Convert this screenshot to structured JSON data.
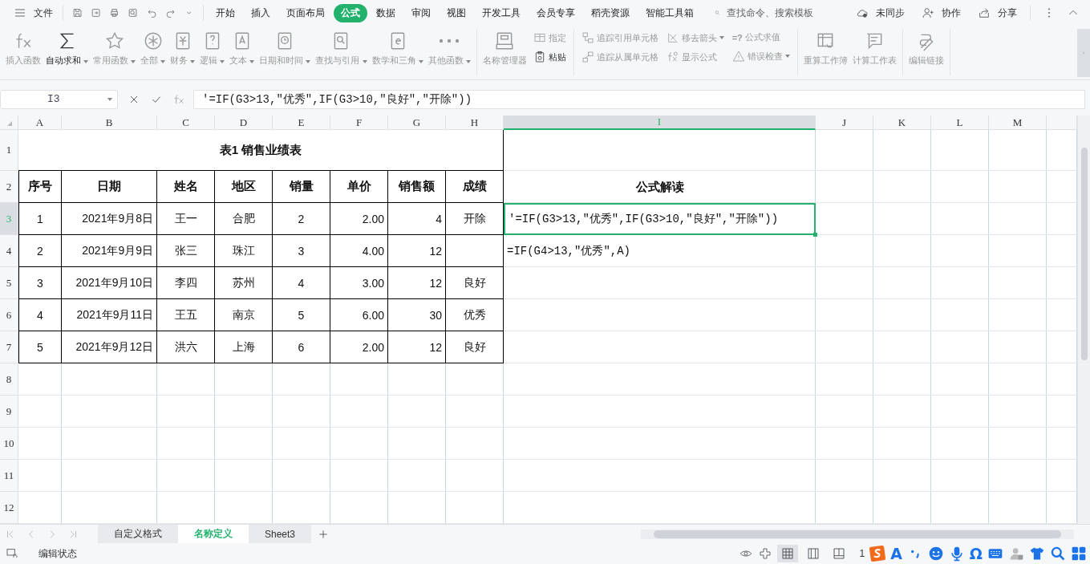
{
  "menu_bar": {
    "file_label": "文件",
    "tabs": [
      {
        "label": "开始",
        "selected": false
      },
      {
        "label": "插入",
        "selected": false
      },
      {
        "label": "页面布局",
        "selected": false
      },
      {
        "label": "公式",
        "selected": true
      },
      {
        "label": "数据",
        "selected": false
      },
      {
        "label": "审阅",
        "selected": false
      },
      {
        "label": "视图",
        "selected": false
      },
      {
        "label": "开发工具",
        "selected": false
      },
      {
        "label": "会员专享",
        "selected": false
      },
      {
        "label": "稻壳资源",
        "selected": false
      },
      {
        "label": "智能工具箱",
        "selected": false
      }
    ],
    "search": {
      "placeholder": "查找命令、搜索模板"
    },
    "actions": [
      "未同步",
      "协作",
      "分享"
    ]
  },
  "ribbon": {
    "groups": [
      [
        {
          "kind": "large",
          "label": "插入函数",
          "dropdown": false,
          "disabled": true
        },
        {
          "kind": "large",
          "label": "自动求和",
          "dropdown": true,
          "disabled": false
        },
        {
          "kind": "large",
          "label": "常用函数",
          "dropdown": true,
          "disabled": true
        },
        {
          "kind": "large",
          "label": "全部",
          "dropdown": true,
          "disabled": true
        },
        {
          "kind": "large",
          "label": "财务",
          "dropdown": true,
          "disabled": true
        },
        {
          "kind": "large",
          "label": "逻辑",
          "dropdown": true,
          "disabled": true
        },
        {
          "kind": "large",
          "label": "文本",
          "dropdown": true,
          "disabled": true
        },
        {
          "kind": "large",
          "label": "日期和时间",
          "dropdown": true,
          "disabled": true
        },
        {
          "kind": "large",
          "label": "查找与引用",
          "dropdown": true,
          "disabled": true
        },
        {
          "kind": "large",
          "label": "数学和三角",
          "dropdown": true,
          "disabled": true
        },
        {
          "kind": "large",
          "label": "其他函数",
          "dropdown": true,
          "disabled": true
        }
      ],
      [
        {
          "kind": "large",
          "label": "名称管理器",
          "dropdown": false,
          "disabled": true
        },
        {
          "kind": "stack",
          "items": [
            {
              "label": "指定",
              "dropdown": false,
              "disabled": true
            },
            {
              "label": "粘贴",
              "dropdown": false,
              "disabled": false
            }
          ]
        }
      ],
      [
        {
          "kind": "stack",
          "items": [
            {
              "label": "追踪引用单元格",
              "dropdown": false,
              "disabled": true
            },
            {
              "label": "追踪从属单元格",
              "dropdown": false,
              "disabled": true
            }
          ]
        },
        {
          "kind": "stack",
          "items": [
            {
              "label": "移去箭头",
              "dropdown": true,
              "disabled": true
            },
            {
              "label": "显示公式",
              "dropdown": false,
              "disabled": true
            }
          ]
        },
        {
          "kind": "stack",
          "items": [
            {
              "label": "公式求值",
              "glyph": "=?",
              "dropdown": false,
              "disabled": true
            },
            {
              "label": "错误检查",
              "dropdown": true,
              "disabled": true
            }
          ]
        }
      ],
      [
        {
          "kind": "large",
          "label": "重算工作簿",
          "dropdown": false,
          "disabled": true
        },
        {
          "kind": "large",
          "label": "计算工作表",
          "dropdown": false,
          "disabled": true
        }
      ],
      [
        {
          "kind": "large",
          "label": "编辑链接",
          "dropdown": false,
          "disabled": true
        }
      ]
    ]
  },
  "formula_bar": {
    "name_box": "I3",
    "formula": "'=IF(G3>13,\"优秀\",IF(G3>10,\"良好\",\"开除\"))"
  },
  "sheet": {
    "columns": [
      {
        "label": "A",
        "selected": false
      },
      {
        "label": "B",
        "selected": false
      },
      {
        "label": "C",
        "selected": false
      },
      {
        "label": "D",
        "selected": false
      },
      {
        "label": "E",
        "selected": false
      },
      {
        "label": "F",
        "selected": false
      },
      {
        "label": "G",
        "selected": false
      },
      {
        "label": "H",
        "selected": false
      },
      {
        "label": "I",
        "selected": true
      },
      {
        "label": "J",
        "selected": false
      },
      {
        "label": "K",
        "selected": false
      },
      {
        "label": "L",
        "selected": false
      },
      {
        "label": "M",
        "selected": false
      }
    ],
    "rows": [
      {
        "label": "1",
        "selected": false,
        "kind": "title",
        "title": "表1 销售业绩表"
      },
      {
        "label": "2",
        "selected": false,
        "kind": "header",
        "cells": [
          "序号",
          "日期",
          "姓名",
          "地区",
          "销量",
          "单价",
          "销售额",
          "成绩",
          "公式解读"
        ]
      },
      {
        "label": "3",
        "selected": true,
        "kind": "data",
        "cells": [
          "1",
          "2021年9月8日",
          "王一",
          "合肥",
          "2",
          "2.00",
          "4",
          "开除",
          "'=IF(G3>13,\"优秀\",IF(G3>10,\"良好\",\"开除\"))"
        ]
      },
      {
        "label": "4",
        "selected": false,
        "kind": "data",
        "cells": [
          "2",
          "2021年9月9日",
          "张三",
          "珠江",
          "3",
          "4.00",
          "12",
          null,
          "=IF(G4>13,\"优秀\",A)"
        ]
      },
      {
        "label": "5",
        "selected": false,
        "kind": "data",
        "cells": [
          "3",
          "2021年9月10日",
          "李四",
          "苏州",
          "4",
          "3.00",
          "12",
          "良好",
          null
        ]
      },
      {
        "label": "6",
        "selected": false,
        "kind": "data",
        "cells": [
          "4",
          "2021年9月11日",
          "王五",
          "南京",
          "5",
          "6.00",
          "30",
          "优秀",
          null
        ]
      },
      {
        "label": "7",
        "selected": false,
        "kind": "data",
        "cells": [
          "5",
          "2021年9月12日",
          "洪六",
          "上海",
          "6",
          "2.00",
          "12",
          "良好",
          null
        ]
      },
      {
        "label": "8",
        "selected": false,
        "kind": "empty"
      },
      {
        "label": "9",
        "selected": false,
        "kind": "empty"
      },
      {
        "label": "10",
        "selected": false,
        "kind": "empty"
      },
      {
        "label": "11",
        "selected": false,
        "kind": "empty"
      },
      {
        "label": "12",
        "selected": false,
        "kind": "empty"
      }
    ]
  },
  "sheet_tabs": [
    {
      "label": "自定义格式",
      "selected": false
    },
    {
      "label": "名称定义",
      "selected": true
    },
    {
      "label": "Sheet3",
      "selected": false
    }
  ],
  "status_bar": {
    "mode": "编辑状态",
    "partial_text": "1",
    "views": [
      {
        "selected": true
      },
      {
        "selected": false
      },
      {
        "selected": false
      }
    ]
  },
  "ime_toolbar": [
    {
      "kind": "logo"
    },
    {
      "kind": "glyph",
      "text": "A"
    },
    {
      "kind": "punct"
    },
    {
      "kind": "smiley"
    },
    {
      "kind": "mic"
    },
    {
      "kind": "glyph",
      "text": "Ω"
    },
    {
      "kind": "keyboard"
    },
    {
      "kind": "user"
    },
    {
      "kind": "shirt"
    },
    {
      "kind": "search"
    },
    {
      "kind": "apps"
    }
  ]
}
